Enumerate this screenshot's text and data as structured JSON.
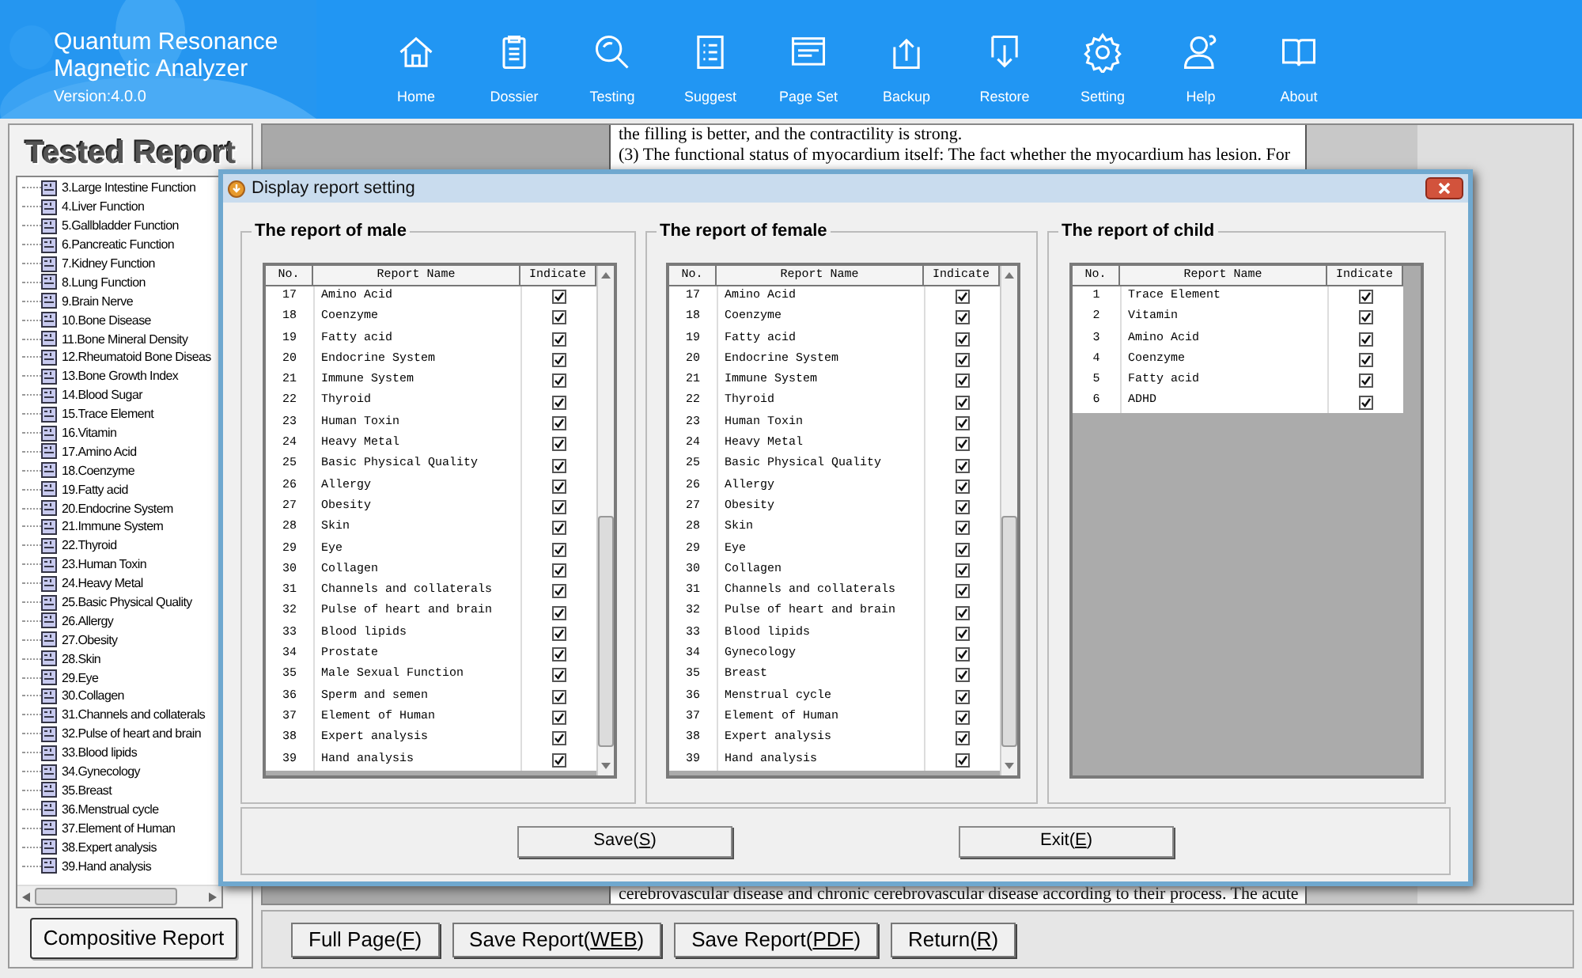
{
  "app": {
    "title_lines": [
      "Quantum Resonance",
      "Magnetic Analyzer"
    ],
    "version": "Version:4.0.0"
  },
  "toolbar": [
    {
      "label": "Home",
      "kind": "home"
    },
    {
      "label": "Dossier",
      "kind": "clipboard"
    },
    {
      "label": "Testing",
      "kind": "magnifier"
    },
    {
      "label": "Suggest",
      "kind": "list"
    },
    {
      "label": "Page Set",
      "kind": "page"
    },
    {
      "label": "Backup",
      "kind": "upload"
    },
    {
      "label": "Restore",
      "kind": "download"
    },
    {
      "label": "Setting",
      "kind": "gear"
    },
    {
      "label": "Help",
      "kind": "person"
    },
    {
      "label": "About",
      "kind": "book"
    }
  ],
  "sidebar": {
    "title": "Tested Report",
    "items": [
      "3.Large Intestine Function",
      "4.Liver Function",
      "5.Gallbladder Function",
      "6.Pancreatic Function",
      "7.Kidney Function",
      "8.Lung Function",
      "9.Brain Nerve",
      "10.Bone Disease",
      "11.Bone Mineral Density",
      "12.Rheumatoid Bone Diseas",
      "13.Bone Growth Index",
      "14.Blood Sugar",
      "15.Trace Element",
      "16.Vitamin",
      "17.Amino Acid",
      "18.Coenzyme",
      "19.Fatty acid",
      "20.Endocrine System",
      "21.Immune System",
      "22.Thyroid",
      "23.Human Toxin",
      "24.Heavy Metal",
      "25.Basic Physical Quality",
      "26.Allergy",
      "27.Obesity",
      "28.Skin",
      "29.Eye",
      "30.Collagen",
      "31.Channels and collaterals",
      "32.Pulse of heart and brain",
      "33.Blood lipids",
      "34.Gynecology",
      "35.Breast",
      "36.Menstrual cycle",
      "37.Element of Human",
      "38.Expert analysis",
      "39.Hand analysis"
    ],
    "button": "Compositive Report"
  },
  "document": {
    "top_lines": [
      "the filling is better, and the contractility is strong.",
      "(3) The functional status of myocardium itself: The fact whether the myocardium has lesion. For"
    ],
    "bottom_lines": [
      "cerebrovascular disease and chronic cerebrovascular disease according to their process. The acute"
    ]
  },
  "bottom_buttons": [
    {
      "text": "Full Page(",
      "key": "F",
      "tail": ")"
    },
    {
      "text": "Save Report(",
      "key": "WEB",
      "tail": ")"
    },
    {
      "text": "Save Report(",
      "key": "PDF",
      "tail": ")"
    },
    {
      "text": "Return(",
      "key": "R",
      "tail": ")"
    }
  ],
  "dialog": {
    "title": "Display report setting",
    "panels": [
      {
        "title": "The report of male",
        "columns": [
          "No.",
          "Report Name",
          "Indicate"
        ],
        "scrollbar": true,
        "rows": [
          {
            "no": "17",
            "name": "Amino Acid",
            "checked": true
          },
          {
            "no": "18",
            "name": "Coenzyme",
            "checked": true
          },
          {
            "no": "19",
            "name": "Fatty acid",
            "checked": true
          },
          {
            "no": "20",
            "name": "Endocrine System",
            "checked": true
          },
          {
            "no": "21",
            "name": "Immune System",
            "checked": true
          },
          {
            "no": "22",
            "name": "Thyroid",
            "checked": true
          },
          {
            "no": "23",
            "name": "Human Toxin",
            "checked": true
          },
          {
            "no": "24",
            "name": "Heavy Metal",
            "checked": true
          },
          {
            "no": "25",
            "name": "Basic Physical Quality",
            "checked": true
          },
          {
            "no": "26",
            "name": "Allergy",
            "checked": true
          },
          {
            "no": "27",
            "name": "Obesity",
            "checked": true
          },
          {
            "no": "28",
            "name": "Skin",
            "checked": true
          },
          {
            "no": "29",
            "name": "Eye",
            "checked": true
          },
          {
            "no": "30",
            "name": "Collagen",
            "checked": true
          },
          {
            "no": "31",
            "name": "Channels and collaterals",
            "checked": true
          },
          {
            "no": "32",
            "name": "Pulse of heart and brain",
            "checked": true
          },
          {
            "no": "33",
            "name": "Blood lipids",
            "checked": true
          },
          {
            "no": "34",
            "name": "Prostate",
            "checked": true
          },
          {
            "no": "35",
            "name": "Male Sexual Function",
            "checked": true
          },
          {
            "no": "36",
            "name": "Sperm and semen",
            "checked": true
          },
          {
            "no": "37",
            "name": "Element of Human",
            "checked": true
          },
          {
            "no": "38",
            "name": "Expert analysis",
            "checked": true
          },
          {
            "no": "39",
            "name": "Hand analysis",
            "checked": true
          }
        ]
      },
      {
        "title": "The report of female",
        "columns": [
          "No.",
          "Report Name",
          "Indicate"
        ],
        "scrollbar": true,
        "rows": [
          {
            "no": "17",
            "name": "Amino Acid",
            "checked": true
          },
          {
            "no": "18",
            "name": "Coenzyme",
            "checked": true
          },
          {
            "no": "19",
            "name": "Fatty acid",
            "checked": true
          },
          {
            "no": "20",
            "name": "Endocrine System",
            "checked": true
          },
          {
            "no": "21",
            "name": "Immune System",
            "checked": true
          },
          {
            "no": "22",
            "name": "Thyroid",
            "checked": true
          },
          {
            "no": "23",
            "name": "Human Toxin",
            "checked": true
          },
          {
            "no": "24",
            "name": "Heavy Metal",
            "checked": true
          },
          {
            "no": "25",
            "name": "Basic Physical Quality",
            "checked": true
          },
          {
            "no": "26",
            "name": "Allergy",
            "checked": true
          },
          {
            "no": "27",
            "name": "Obesity",
            "checked": true
          },
          {
            "no": "28",
            "name": "Skin",
            "checked": true
          },
          {
            "no": "29",
            "name": "Eye",
            "checked": true
          },
          {
            "no": "30",
            "name": "Collagen",
            "checked": true
          },
          {
            "no": "31",
            "name": "Channels and collaterals",
            "checked": true
          },
          {
            "no": "32",
            "name": "Pulse of heart and brain",
            "checked": true
          },
          {
            "no": "33",
            "name": "Blood lipids",
            "checked": true
          },
          {
            "no": "34",
            "name": "Gynecology",
            "checked": true
          },
          {
            "no": "35",
            "name": "Breast",
            "checked": true
          },
          {
            "no": "36",
            "name": "Menstrual cycle",
            "checked": true
          },
          {
            "no": "37",
            "name": "Element of Human",
            "checked": true
          },
          {
            "no": "38",
            "name": "Expert analysis",
            "checked": true
          },
          {
            "no": "39",
            "name": "Hand analysis",
            "checked": true
          }
        ]
      },
      {
        "title": "The report of child",
        "columns": [
          "No.",
          "Report Name",
          "Indicate"
        ],
        "scrollbar": false,
        "rows": [
          {
            "no": "1",
            "name": "Trace Element",
            "checked": true
          },
          {
            "no": "2",
            "name": "Vitamin",
            "checked": true
          },
          {
            "no": "3",
            "name": "Amino Acid",
            "checked": true
          },
          {
            "no": "4",
            "name": "Coenzyme",
            "checked": true
          },
          {
            "no": "5",
            "name": "Fatty acid",
            "checked": true
          },
          {
            "no": "6",
            "name": "ADHD",
            "checked": true
          }
        ]
      }
    ],
    "buttons": [
      {
        "text": "Save(",
        "key": "S",
        "tail": ")"
      },
      {
        "text": "Exit(",
        "key": "E",
        "tail": ")"
      }
    ]
  }
}
